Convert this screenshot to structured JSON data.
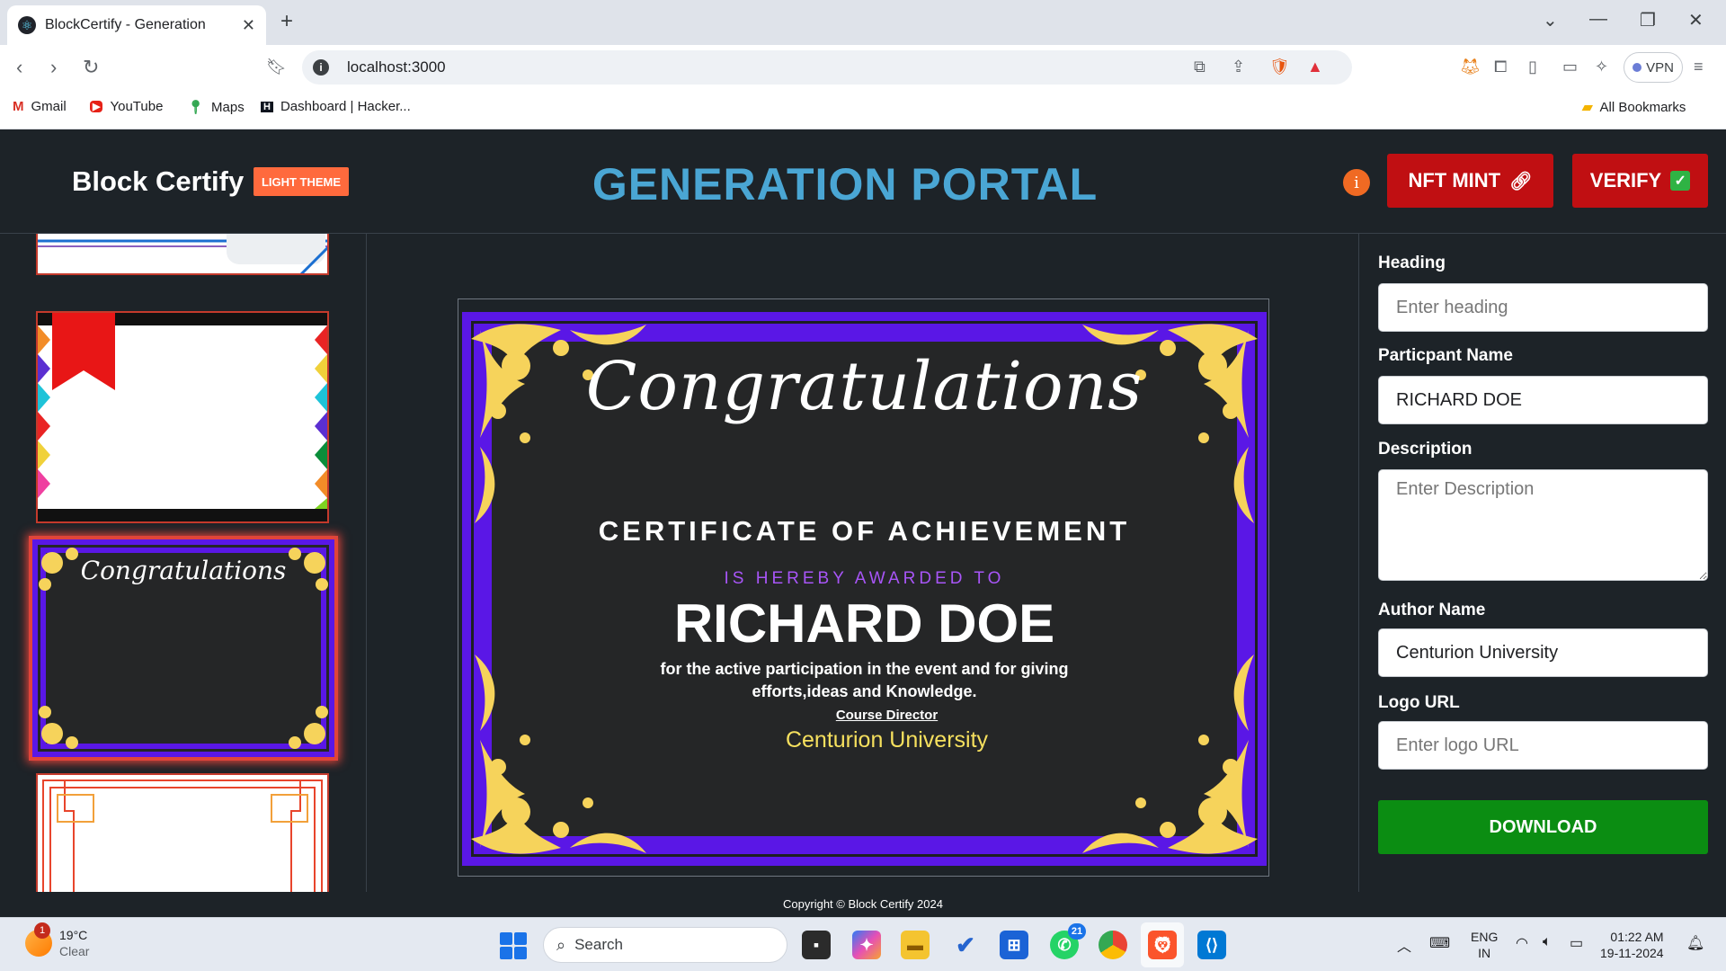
{
  "browser": {
    "tab_title": "BlockCertify - Generation",
    "url": "localhost:3000",
    "vpn_label": "VPN",
    "bookmarks": [
      {
        "label": "Gmail"
      },
      {
        "label": "YouTube"
      },
      {
        "label": "Maps"
      },
      {
        "label": "Dashboard | Hacker..."
      }
    ],
    "all_bookmarks": "All Bookmarks"
  },
  "header": {
    "brand": "Block Certify",
    "theme_button": "LIGHT THEME",
    "title": "GENERATION PORTAL",
    "info_label": "i",
    "nft_button": "NFT MINT",
    "verify_button": "VERIFY"
  },
  "certificate": {
    "script_heading": "Congratulations",
    "title": "CERTIFICATE OF ACHIEVEMENT",
    "awarded_to": "IS HEREBY AWARDED TO",
    "participant": "RICHARD DOE",
    "description": "for the active participation in the event and for giving efforts,ideas and Knowledge.",
    "director_label": "Course Director",
    "author": "Centurion University",
    "colors": {
      "border": "#5a17e6",
      "ornament": "#f6d35b",
      "background": "#252627"
    }
  },
  "thumbnails": {
    "selected_script": "Congratulations"
  },
  "form": {
    "heading_label": "Heading",
    "heading_placeholder": "Enter heading",
    "heading_value": "",
    "participant_label": "Particpant Name",
    "participant_value": "RICHARD DOE",
    "description_label": "Description",
    "description_placeholder": "Enter Description",
    "author_label": "Author Name",
    "author_value": "Centurion University",
    "logo_label": "Logo URL",
    "logo_placeholder": "Enter logo URL",
    "download_button": "DOWNLOAD"
  },
  "footer": {
    "copyright": "Copyright © Block Certify 2024"
  },
  "taskbar": {
    "temperature": "19°C",
    "condition": "Clear",
    "weather_badge": "1",
    "search_label": "Search",
    "whatsapp_badge": "21",
    "lang_top": "ENG",
    "lang_bottom": "IN",
    "time": "01:22 AM",
    "date": "19-11-2024"
  }
}
